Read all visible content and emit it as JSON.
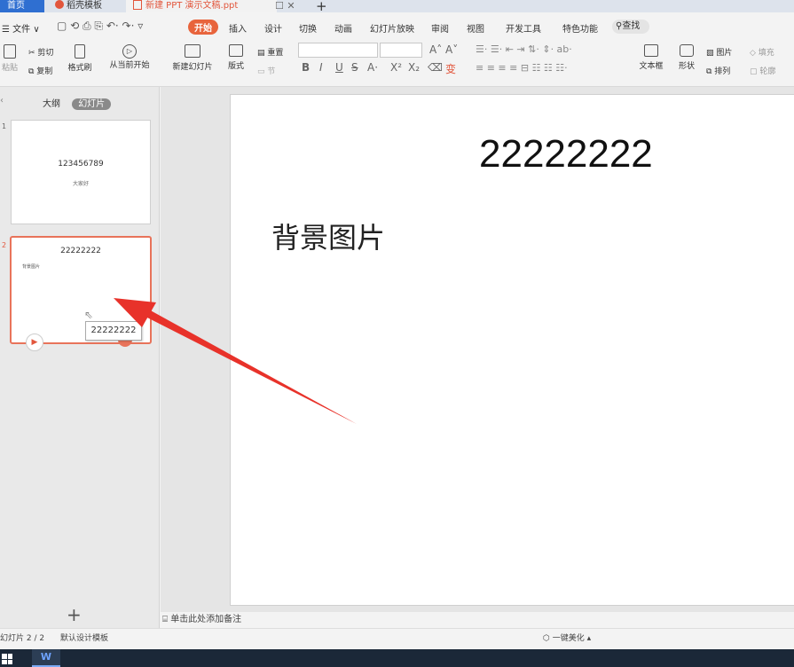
{
  "tabs": {
    "home": "首页",
    "templates": "稻壳模板",
    "document": "新建 PPT 演示文稿.ppt",
    "close": "✕",
    "new_tab": "+"
  },
  "menu": {
    "file": "☰ 文件 ∨",
    "items": [
      "开始",
      "插入",
      "设计",
      "切换",
      "动画",
      "幻灯片放映",
      "审阅",
      "视图",
      "开发工具",
      "特色功能"
    ],
    "search": "查找"
  },
  "ribbon": {
    "paste": "粘贴",
    "cut": "剪切",
    "copy": "复制",
    "format_painter": "格式刷",
    "from_current": "从当前开始",
    "new_slide": "新建幻灯片",
    "layout": "版式",
    "reset": "重置",
    "section": "节",
    "textbox": "文本框",
    "shape": "形状",
    "picture": "图片",
    "arrange": "排列",
    "fill": "填充",
    "outline": "轮廓"
  },
  "panel": {
    "outline_tab": "大纲",
    "slides_tab": "幻灯片",
    "add": "+"
  },
  "slides": [
    {
      "number": "1",
      "title": "123456789",
      "subtitle": "大家好"
    },
    {
      "number": "2",
      "title": "22222222",
      "body": "背景图片"
    }
  ],
  "tooltip": "22222222",
  "main_slide": {
    "title": "22222222",
    "body": "背景图片"
  },
  "notes_placeholder": "单击此处添加备注",
  "status": {
    "slide_count": "幻灯片 2 / 2",
    "template": "默认设计模板",
    "beautify": "一键美化"
  },
  "colors": {
    "accent": "#e8643c",
    "active_tab": "#2f6fd1",
    "arrow": "#e8322a"
  }
}
